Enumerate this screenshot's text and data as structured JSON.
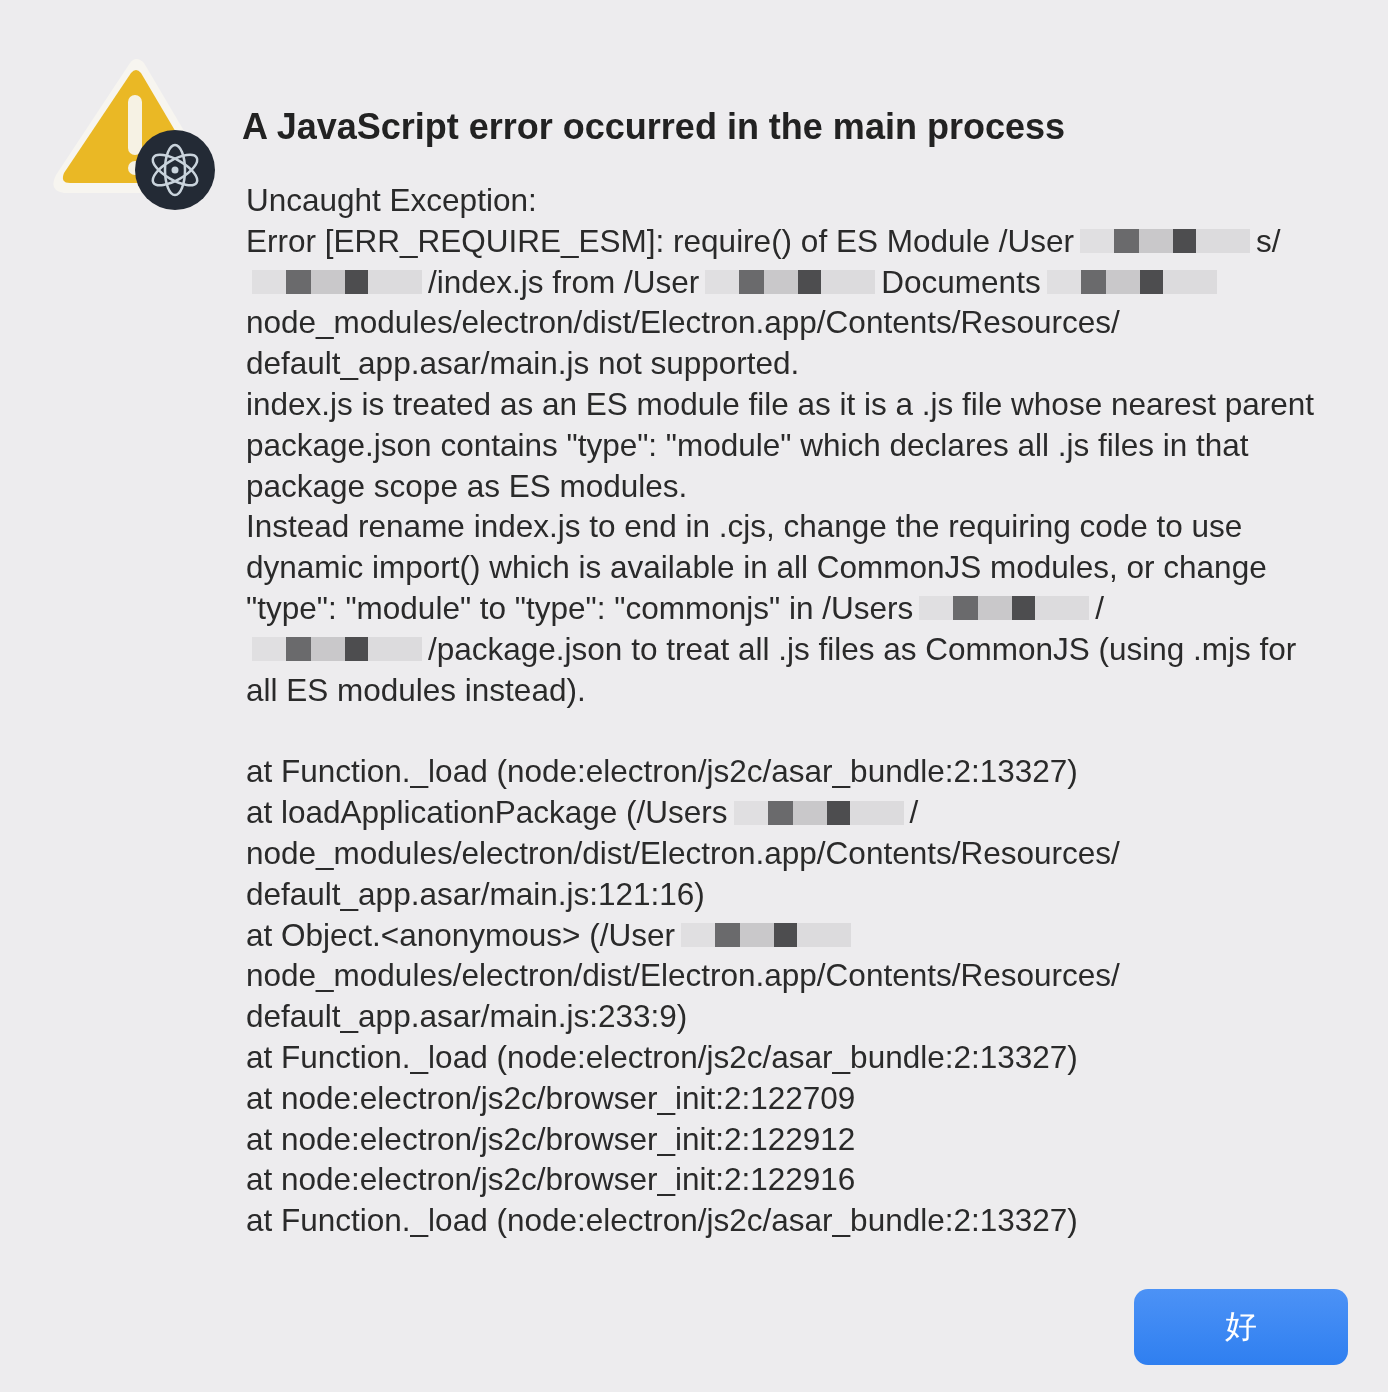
{
  "dialog": {
    "title": "A JavaScript error occurred in the main process",
    "message": [
      {
        "segments": [
          {
            "kind": "text",
            "text": "Uncaught Exception:"
          }
        ]
      },
      {
        "segments": [
          {
            "kind": "text",
            "text": "Error [ERR_REQUIRE_ESM]: require() of ES Module /User"
          },
          {
            "kind": "redacted"
          },
          {
            "kind": "text",
            "text": "s/"
          }
        ]
      },
      {
        "segments": [
          {
            "kind": "redacted"
          },
          {
            "kind": "text",
            "text": "/index.js from /User"
          },
          {
            "kind": "redacted"
          },
          {
            "kind": "text",
            "text": "Documents"
          },
          {
            "kind": "redacted"
          }
        ]
      },
      {
        "segments": [
          {
            "kind": "text",
            "text": "node_modules/electron/dist/Electron.app/Contents/Resources/"
          }
        ]
      },
      {
        "segments": [
          {
            "kind": "text",
            "text": "default_app.asar/main.js not supported."
          }
        ]
      },
      {
        "segments": [
          {
            "kind": "text",
            "text": "index.js is treated as an ES module file as it is a .js file whose nearest parent"
          }
        ]
      },
      {
        "segments": [
          {
            "kind": "text",
            "text": "package.json contains \"type\": \"module\" which declares all .js files in that"
          }
        ]
      },
      {
        "segments": [
          {
            "kind": "text",
            "text": "package scope as ES modules."
          }
        ]
      },
      {
        "segments": [
          {
            "kind": "text",
            "text": "Instead rename index.js to end in .cjs, change the requiring code to use"
          }
        ]
      },
      {
        "segments": [
          {
            "kind": "text",
            "text": "dynamic import() which is available in all CommonJS modules, or change"
          }
        ]
      },
      {
        "segments": [
          {
            "kind": "text",
            "text": "\"type\": \"module\" to \"type\": \"commonjs\" in /Users"
          },
          {
            "kind": "redacted"
          },
          {
            "kind": "text",
            "text": "/"
          }
        ]
      },
      {
        "segments": [
          {
            "kind": "redacted"
          },
          {
            "kind": "text",
            "text": "/package.json to treat all .js files as CommonJS (using .mjs for"
          }
        ]
      },
      {
        "segments": [
          {
            "kind": "text",
            "text": "all ES modules instead)."
          }
        ]
      }
    ],
    "stack": [
      {
        "segments": [
          {
            "kind": "text",
            "text": "at Function._load (node:electron/js2c/asar_bundle:2:13327)"
          }
        ]
      },
      {
        "segments": [
          {
            "kind": "text",
            "text": "at loadApplicationPackage (/Users"
          },
          {
            "kind": "redacted"
          },
          {
            "kind": "text",
            "text": "/"
          }
        ]
      },
      {
        "segments": [
          {
            "kind": "text",
            "text": "node_modules/electron/dist/Electron.app/Contents/Resources/"
          }
        ]
      },
      {
        "segments": [
          {
            "kind": "text",
            "text": "default_app.asar/main.js:121:16)"
          }
        ]
      },
      {
        "segments": [
          {
            "kind": "text",
            "text": "at Object.<anonymous> (/User"
          },
          {
            "kind": "redacted"
          }
        ]
      },
      {
        "segments": [
          {
            "kind": "text",
            "text": "node_modules/electron/dist/Electron.app/Contents/Resources/"
          }
        ]
      },
      {
        "segments": [
          {
            "kind": "text",
            "text": "default_app.asar/main.js:233:9)"
          }
        ]
      },
      {
        "segments": [
          {
            "kind": "text",
            "text": "at Function._load (node:electron/js2c/asar_bundle:2:13327)"
          }
        ]
      },
      {
        "segments": [
          {
            "kind": "text",
            "text": "at node:electron/js2c/browser_init:2:122709"
          }
        ]
      },
      {
        "segments": [
          {
            "kind": "text",
            "text": "at node:electron/js2c/browser_init:2:122912"
          }
        ]
      },
      {
        "segments": [
          {
            "kind": "text",
            "text": "at node:electron/js2c/browser_init:2:122916"
          }
        ]
      },
      {
        "segments": [
          {
            "kind": "text",
            "text": "at Function._load (node:electron/js2c/asar_bundle:2:13327)"
          }
        ]
      }
    ],
    "buttons": [
      {
        "label": "好",
        "default": true
      }
    ]
  }
}
